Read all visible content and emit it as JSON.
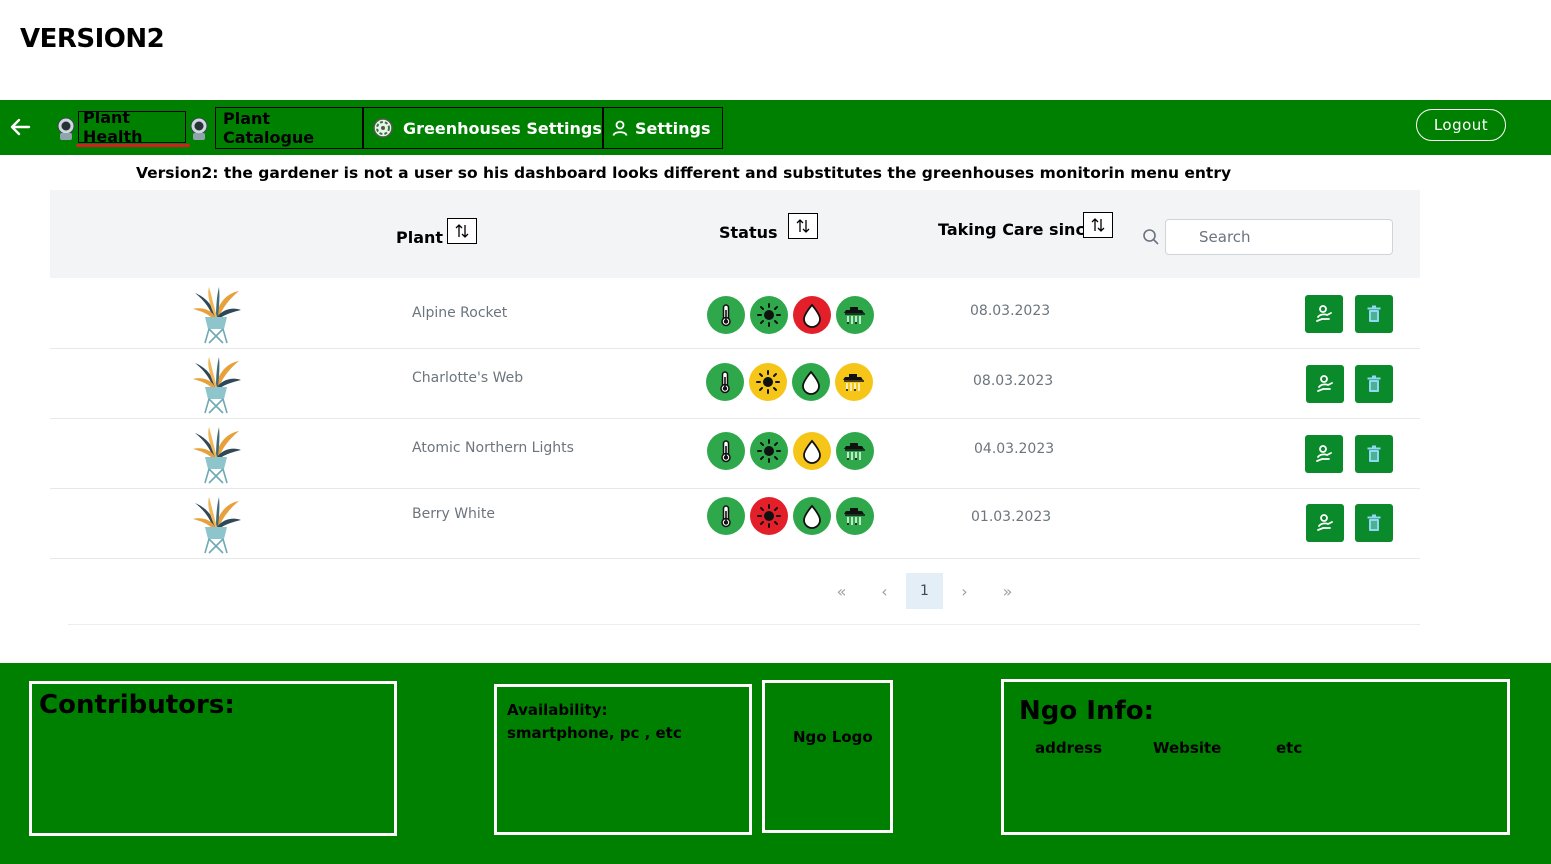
{
  "version_title": "VERSION2",
  "nav": {
    "plant_health": "Plant Health",
    "plant_catalogue": "Plant Catalogue",
    "greenhouses_settings": "Greenhouses Settings",
    "settings": "Settings",
    "logout": "Logout"
  },
  "note": "Version2: the gardener is not a user so his dashboard looks different and substitutes the greenhouses monitorin menu entry",
  "table": {
    "columns": {
      "plant": "Plant",
      "status": "Status",
      "since": "Taking Care since"
    },
    "search_placeholder": "Search",
    "rows": [
      {
        "name": "Alpine Rocket",
        "date": "08.03.2023",
        "status": [
          "green",
          "green",
          "red",
          "green"
        ]
      },
      {
        "name": "Charlotte's Web",
        "date": "08.03.2023",
        "status": [
          "green",
          "yellow",
          "green",
          "yellow"
        ]
      },
      {
        "name": "Atomic Northern Lights",
        "date": "04.03.2023",
        "status": [
          "green",
          "green",
          "yellow",
          "green"
        ]
      },
      {
        "name": "Berry White",
        "date": "01.03.2023",
        "status": [
          "green",
          "red",
          "green",
          "green"
        ]
      }
    ],
    "status_icons": [
      "thermometer-icon",
      "sun-icon",
      "water-drop-icon",
      "fertilizer-icon"
    ]
  },
  "pagination": {
    "first": "«",
    "prev": "‹",
    "current": "1",
    "next": "›",
    "last": "»"
  },
  "footer": {
    "contributors": "Contributors:",
    "availability_title": "Availability:",
    "availability_text": "smartphone, pc , etc",
    "ngo_logo": "Ngo Logo",
    "ngo_info": "Ngo Info:",
    "ngo_items": [
      "address",
      "Website",
      "etc"
    ]
  },
  "colors": {
    "green_bar": "#008000",
    "status_green": "#2ea84a",
    "status_yellow": "#f5c518",
    "status_red": "#e3202a",
    "action_green": "#0a8a2a"
  }
}
